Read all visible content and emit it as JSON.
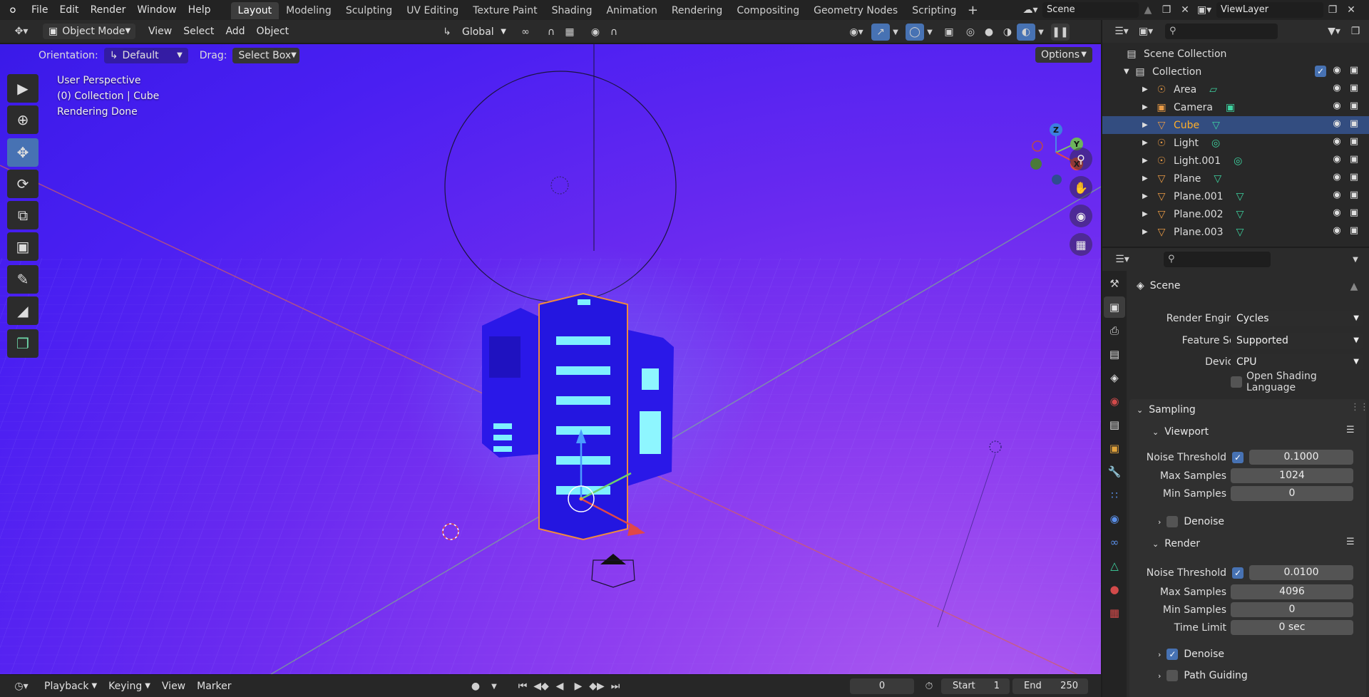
{
  "topbar": {
    "menus": [
      "File",
      "Edit",
      "Render",
      "Window",
      "Help"
    ],
    "workspaces": [
      "Layout",
      "Modeling",
      "Sculpting",
      "UV Editing",
      "Texture Paint",
      "Shading",
      "Animation",
      "Rendering",
      "Compositing",
      "Geometry Nodes",
      "Scripting"
    ],
    "active_workspace": "Layout",
    "scene": "Scene",
    "view_layer": "ViewLayer"
  },
  "viewport_header": {
    "mode": "Object Mode",
    "menus": [
      "View",
      "Select",
      "Add",
      "Object"
    ],
    "transform_orientation": "Global"
  },
  "tool_header": {
    "orientation_label": "Orientation:",
    "orientation_value": "Default",
    "drag_label": "Drag:",
    "drag_value": "Select Box",
    "options": "Options"
  },
  "viewport": {
    "info_line1": "User Perspective",
    "info_line2": "(0) Collection | Cube",
    "info_line3": "Rendering Done",
    "gizmo": {
      "z": "Z",
      "y": "Y",
      "x": "X"
    }
  },
  "timeline": {
    "menus": [
      "Playback",
      "Keying",
      "View",
      "Marker"
    ],
    "current_frame": "0",
    "start_label": "Start",
    "start": "1",
    "end_label": "End",
    "end": "250"
  },
  "outliner": {
    "root": "Scene Collection",
    "collection": "Collection",
    "items": [
      {
        "name": "Area",
        "icon": "light-icon",
        "data": "area-light-data-icon"
      },
      {
        "name": "Camera",
        "icon": "camera-icon",
        "data": "camera-data-icon"
      },
      {
        "name": "Cube",
        "icon": "mesh-icon",
        "data": "mesh-data-icon",
        "selected": true
      },
      {
        "name": "Light",
        "icon": "light-icon",
        "data": "point-light-data-icon"
      },
      {
        "name": "Light.001",
        "icon": "light-icon",
        "data": "point-light-data-icon"
      },
      {
        "name": "Plane",
        "icon": "mesh-icon",
        "data": "mesh-data-icon"
      },
      {
        "name": "Plane.001",
        "icon": "mesh-icon",
        "data": "mesh-data-icon"
      },
      {
        "name": "Plane.002",
        "icon": "mesh-icon",
        "data": "mesh-data-icon"
      },
      {
        "name": "Plane.003",
        "icon": "mesh-icon",
        "data": "mesh-data-icon"
      }
    ]
  },
  "properties": {
    "context": "Scene",
    "render_engine_label": "Render Engine",
    "render_engine": "Cycles",
    "feature_set_label": "Feature Set",
    "feature_set": "Supported",
    "device_label": "Device",
    "device": "CPU",
    "osl_label": "Open Shading Language",
    "sampling": "Sampling",
    "viewport_panel": "Viewport",
    "render_panel": "Render",
    "noise_threshold_label": "Noise Threshold",
    "max_samples_label": "Max Samples",
    "min_samples_label": "Min Samples",
    "time_limit_label": "Time Limit",
    "denoise_label": "Denoise",
    "path_guiding_label": "Path Guiding",
    "viewport_noise": "0.1000",
    "viewport_max": "1024",
    "viewport_min": "0",
    "render_noise": "0.0100",
    "render_max": "4096",
    "render_min": "0",
    "render_time_limit": "0 sec"
  }
}
